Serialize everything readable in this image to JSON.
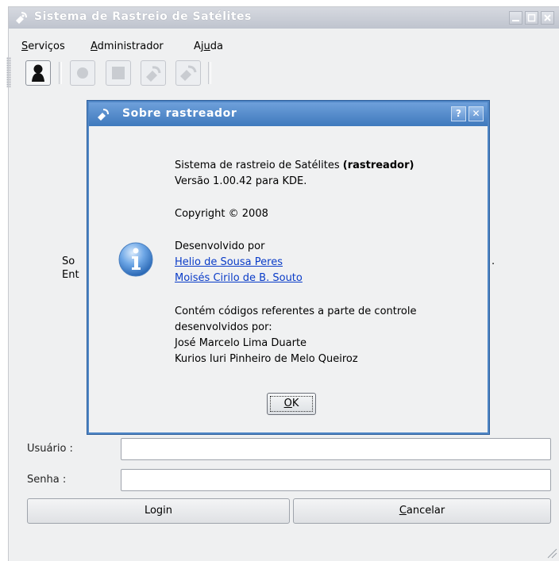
{
  "window": {
    "title": "Sistema de Rastreio de Satélites",
    "icon": "satellite-dish-icon",
    "controls": [
      "minimize-icon",
      "maximize-icon",
      "close-icon"
    ]
  },
  "menubar": {
    "servicos": {
      "pre": "",
      "u": "S",
      "post": "erviços"
    },
    "administrador": {
      "pre": "",
      "u": "A",
      "post": "dministrador"
    },
    "ajuda": {
      "pre": "Aj",
      "u": "u",
      "post": "da"
    }
  },
  "toolbar": {
    "icons": [
      "user-icon",
      "record-icon",
      "stop-icon",
      "satellite-icon",
      "satellite-dish-icon"
    ]
  },
  "background": {
    "line1_start": "So",
    "line1_end": ".",
    "line2_start": "Ent"
  },
  "form": {
    "user_label": "Usuário :",
    "user_value": "",
    "password_label": "Senha :",
    "password_value": "",
    "login_button": "Login",
    "cancel_button": {
      "pre": "",
      "u": "C",
      "post": "ancelar"
    }
  },
  "dialog": {
    "title": "Sobre rastreador",
    "icon": "satellite-dish-icon",
    "help_label": "?",
    "close_label": "✕",
    "app_line_prefix": "Sistema de rastreio de Satélites",
    "app_line_bold": "(rastreador)",
    "version": "Versão 1.00.42 para KDE.",
    "copyright": "Copyright © 2008",
    "developed_by": "Desenvolvido por",
    "authors": [
      "Helio de Sousa Peres",
      "Moisés Cirilo de B. Souto"
    ],
    "contains_line1": "Contém códigos referentes a parte de controle",
    "contains_line2": "desenvolvidos por:",
    "contributors": [
      "José Marcelo Lima Duarte",
      "Kurios Iuri Pinheiro de Melo Queiroz"
    ],
    "ok_button": {
      "pre": "",
      "u": "O",
      "post": "K"
    },
    "info_icon": "info-icon"
  },
  "colors": {
    "dialog_title": "#4a84c8",
    "link": "#0a3cc8",
    "window_bg": "#eff0f1"
  }
}
